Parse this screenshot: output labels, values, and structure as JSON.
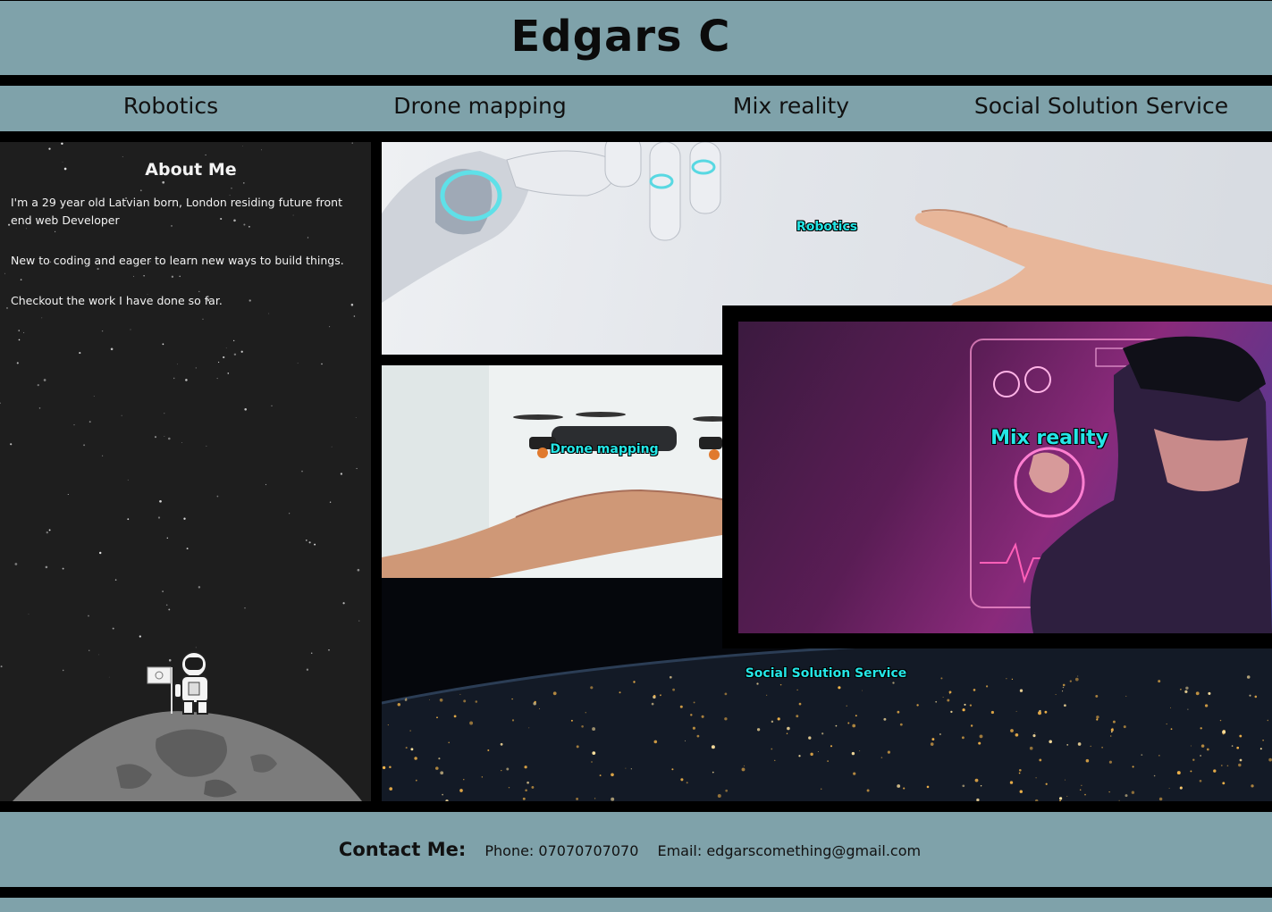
{
  "header": {
    "title": "Edgars C"
  },
  "nav": {
    "items": [
      {
        "label": "Robotics"
      },
      {
        "label": "Drone mapping"
      },
      {
        "label": "Mix reality"
      },
      {
        "label": "Social Solution Service"
      }
    ]
  },
  "about": {
    "title": "About Me",
    "paragraphs": [
      "I'm a 29 year old Latvian born, London residing future front end web Developer",
      "New to coding and eager to learn new ways to build things.",
      "Checkout the work I have done so far."
    ]
  },
  "tiles": {
    "robotics": {
      "label": "Robotics"
    },
    "drone": {
      "label": "Drone mapping"
    },
    "mix_reality": {
      "label": "Mix reality"
    },
    "social": {
      "label": "Social Solution Service"
    }
  },
  "footer": {
    "contact_title": "Contact Me:",
    "phone": "Phone: 07070707070",
    "email": "Email: edgarscomething@gmail.com"
  },
  "colors": {
    "band": "#7fa2aa",
    "panel": "#1e1e1e",
    "label_cyan": "#24e6e6"
  }
}
